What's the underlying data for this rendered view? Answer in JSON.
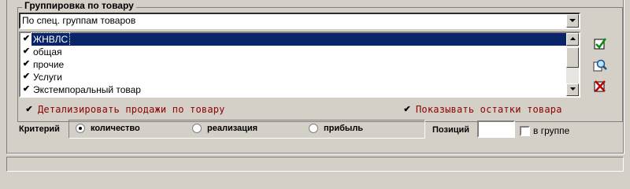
{
  "grouping": {
    "title": "Группировка по товару",
    "combo_value": "По спец. группам товаров",
    "items": [
      {
        "label": "ЖНВЛС",
        "checked": true,
        "selected": true
      },
      {
        "label": "общая",
        "checked": true,
        "selected": false
      },
      {
        "label": "прочие",
        "checked": true,
        "selected": false
      },
      {
        "label": "Услуги",
        "checked": true,
        "selected": false
      },
      {
        "label": "Экстемпоральный товар",
        "checked": true,
        "selected": false
      }
    ]
  },
  "tools": {
    "check_all_icon": "check-icon",
    "find_icon": "search-icon",
    "uncheck_all_icon": "delete-icon"
  },
  "options": {
    "detail_sales_label": "Детализировать продажи по товару",
    "detail_sales_checked": true,
    "show_stock_label": "Показывать остатки товара",
    "show_stock_checked": true
  },
  "criteria": {
    "label": "Критерий",
    "options": [
      {
        "label": "количество",
        "selected": true
      },
      {
        "label": "реализация",
        "selected": false
      },
      {
        "label": "прибыль",
        "selected": false
      }
    ]
  },
  "positions": {
    "label": "Позиций",
    "value": "",
    "in_group_label": "в группе",
    "in_group_checked": false
  },
  "colors": {
    "window_bg": "#d4d0c8",
    "selection": "#0a246a",
    "option_text": "#8b0000"
  }
}
